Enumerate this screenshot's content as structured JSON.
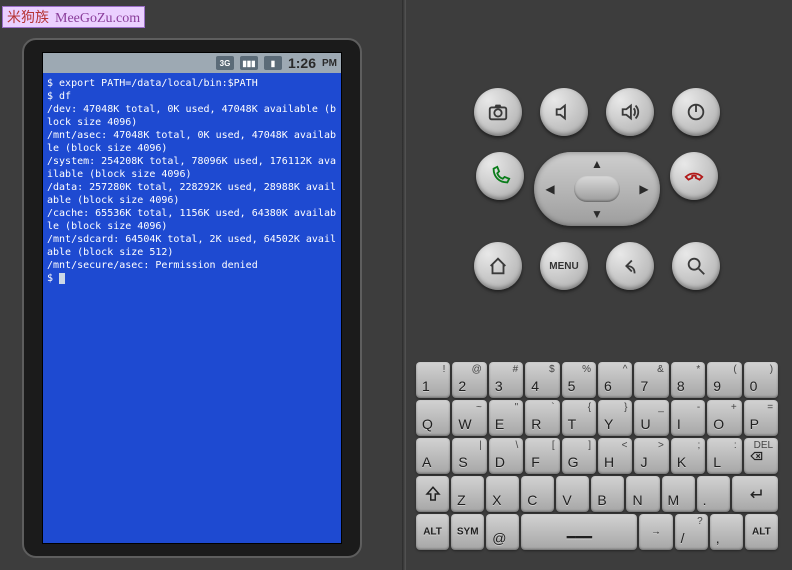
{
  "watermark": {
    "cn": "米狗族",
    "domain": "MeeGoZu.com"
  },
  "statusbar": {
    "net": "3G",
    "time": "1:26",
    "ampm": "PM"
  },
  "terminal": {
    "lines": [
      "$ export PATH=/data/local/bin:$PATH",
      "$ df",
      "/dev: 47048K total, 0K used, 47048K available (block size 4096)",
      "/mnt/asec: 47048K total, 0K used, 47048K available (block size 4096)",
      "/system: 254208K total, 78096K used, 176112K available (block size 4096)",
      "/data: 257280K total, 228292K used, 28988K available (block size 4096)",
      "/cache: 65536K total, 1156K used, 64380K available (block size 4096)",
      "/mnt/sdcard: 64504K total, 2K used, 64502K available (block size 512)",
      "/mnt/secure/asec: Permission denied",
      "$ "
    ]
  },
  "hw": {
    "camera": "camera",
    "volDown": "vol-down",
    "volUp": "vol-up",
    "power": "power",
    "call": "call",
    "end": "end",
    "home": "home",
    "menu": "MENU",
    "back": "back",
    "search": "search"
  },
  "kbd": {
    "row1": [
      {
        "m": "1",
        "a": "!"
      },
      {
        "m": "2",
        "a": "@"
      },
      {
        "m": "3",
        "a": "#"
      },
      {
        "m": "4",
        "a": "$"
      },
      {
        "m": "5",
        "a": "%"
      },
      {
        "m": "6",
        "a": "^"
      },
      {
        "m": "7",
        "a": "&"
      },
      {
        "m": "8",
        "a": "*"
      },
      {
        "m": "9",
        "a": "("
      },
      {
        "m": "0",
        "a": ")"
      }
    ],
    "row2": [
      {
        "m": "Q"
      },
      {
        "m": "W",
        "a": "~"
      },
      {
        "m": "E",
        "a": "\""
      },
      {
        "m": "R",
        "a": "`"
      },
      {
        "m": "T",
        "a": "{"
      },
      {
        "m": "Y",
        "a": "}"
      },
      {
        "m": "U",
        "a": "_"
      },
      {
        "m": "I",
        "a": "-"
      },
      {
        "m": "O",
        "a": "+"
      },
      {
        "m": "P",
        "a": "="
      }
    ],
    "row3": [
      {
        "m": "A"
      },
      {
        "m": "S",
        "a": "|"
      },
      {
        "m": "D",
        "a": "\\"
      },
      {
        "m": "F",
        "a": "["
      },
      {
        "m": "G",
        "a": "]"
      },
      {
        "m": "H",
        "a": "<"
      },
      {
        "m": "J",
        "a": ">"
      },
      {
        "m": "K",
        "a": ";"
      },
      {
        "m": "L",
        "a": ":"
      },
      {
        "m": "DEL",
        "del": true
      }
    ],
    "row4": [
      {
        "shift": true
      },
      {
        "m": "Z"
      },
      {
        "m": "X"
      },
      {
        "m": "C"
      },
      {
        "m": "V"
      },
      {
        "m": "B"
      },
      {
        "m": "N"
      },
      {
        "m": "M"
      },
      {
        "m": "."
      },
      {
        "enter": true
      }
    ],
    "row5": [
      {
        "m": "ALT",
        "sm": true
      },
      {
        "m": "SYM",
        "sm": true
      },
      {
        "m": "@"
      },
      {
        "space": true
      },
      {
        "m": "→",
        "sm": true
      },
      {
        "m": "/",
        "a": "?"
      },
      {
        "m": ",",
        "a": ""
      },
      {
        "m": "ALT",
        "sm": true
      }
    ]
  }
}
